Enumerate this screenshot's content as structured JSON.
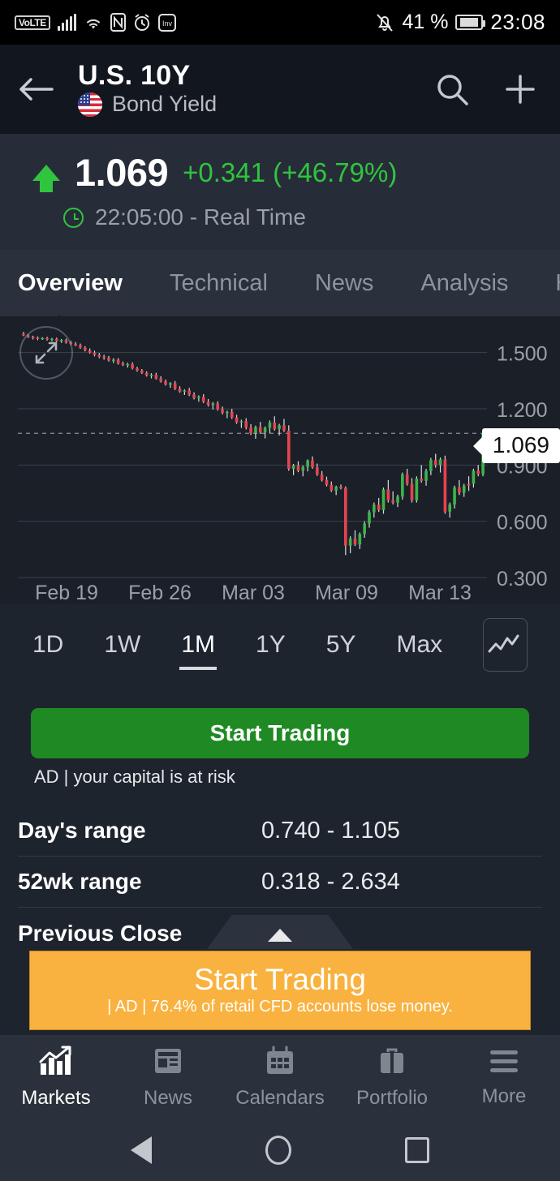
{
  "status_bar": {
    "volte": "VoLTE",
    "icons": [
      "signal-bars-icon",
      "wifi-icon",
      "nfc-icon",
      "alarm-icon",
      "investing-app-icon",
      "bell-mute-icon"
    ],
    "battery_percent": "41 %",
    "time": "23:08"
  },
  "header": {
    "title": "U.S. 10Y",
    "subtitle": "Bond Yield",
    "flag": "us-flag-icon",
    "back_icon": "back-arrow-icon",
    "search_icon": "search-icon",
    "add_icon": "plus-icon"
  },
  "quote": {
    "price": "1.069",
    "change": "+0.341 (+46.79%)",
    "direction": "up",
    "time": "22:05:00 - Real Time",
    "up_color": "#31c43f"
  },
  "tabs": [
    {
      "label": "Overview",
      "active": true
    },
    {
      "label": "Technical",
      "active": false
    },
    {
      "label": "News",
      "active": false
    },
    {
      "label": "Analysis",
      "active": false
    },
    {
      "label": "H",
      "active": false
    }
  ],
  "chart_data": {
    "type": "candlestick",
    "title": "U.S. 10Y Bond Yield",
    "xlabel": "",
    "ylabel": "",
    "ylim": [
      0.3,
      1.65
    ],
    "yticks": [
      "1.500",
      "1.200",
      "0.900",
      "0.600",
      "0.300"
    ],
    "ytick_values": [
      1.5,
      1.2,
      0.9,
      0.6,
      0.3
    ],
    "xticks": [
      "Feb 19",
      "Feb 26",
      "Mar 03",
      "Mar 09",
      "Mar 13"
    ],
    "current_price_label": "1.069",
    "current_price": 1.069,
    "grid": true,
    "up_color": "#3cb44a",
    "down_color": "#e8434f",
    "candles": [
      {
        "o": 1.6,
        "h": 1.61,
        "l": 1.588,
        "c": 1.592,
        "d": "down"
      },
      {
        "o": 1.592,
        "h": 1.598,
        "l": 1.578,
        "c": 1.584,
        "d": "down"
      },
      {
        "o": 1.584,
        "h": 1.59,
        "l": 1.57,
        "c": 1.58,
        "d": "down"
      },
      {
        "o": 1.58,
        "h": 1.586,
        "l": 1.566,
        "c": 1.574,
        "d": "down"
      },
      {
        "o": 1.574,
        "h": 1.582,
        "l": 1.568,
        "c": 1.578,
        "d": "up"
      },
      {
        "o": 1.578,
        "h": 1.584,
        "l": 1.564,
        "c": 1.57,
        "d": "down"
      },
      {
        "o": 1.57,
        "h": 1.578,
        "l": 1.56,
        "c": 1.574,
        "d": "up"
      },
      {
        "o": 1.574,
        "h": 1.58,
        "l": 1.556,
        "c": 1.562,
        "d": "down"
      },
      {
        "o": 1.562,
        "h": 1.572,
        "l": 1.552,
        "c": 1.566,
        "d": "up"
      },
      {
        "o": 1.566,
        "h": 1.574,
        "l": 1.548,
        "c": 1.554,
        "d": "down"
      },
      {
        "o": 1.554,
        "h": 1.562,
        "l": 1.54,
        "c": 1.546,
        "d": "down"
      },
      {
        "o": 1.546,
        "h": 1.556,
        "l": 1.534,
        "c": 1.54,
        "d": "down"
      },
      {
        "o": 1.54,
        "h": 1.548,
        "l": 1.52,
        "c": 1.526,
        "d": "down"
      },
      {
        "o": 1.526,
        "h": 1.534,
        "l": 1.506,
        "c": 1.512,
        "d": "down"
      },
      {
        "o": 1.512,
        "h": 1.522,
        "l": 1.494,
        "c": 1.5,
        "d": "down"
      },
      {
        "o": 1.5,
        "h": 1.51,
        "l": 1.48,
        "c": 1.488,
        "d": "down"
      },
      {
        "o": 1.488,
        "h": 1.498,
        "l": 1.47,
        "c": 1.478,
        "d": "down"
      },
      {
        "o": 1.478,
        "h": 1.488,
        "l": 1.462,
        "c": 1.472,
        "d": "down"
      },
      {
        "o": 1.472,
        "h": 1.482,
        "l": 1.452,
        "c": 1.458,
        "d": "down"
      },
      {
        "o": 1.458,
        "h": 1.47,
        "l": 1.444,
        "c": 1.462,
        "d": "up"
      },
      {
        "o": 1.462,
        "h": 1.47,
        "l": 1.436,
        "c": 1.442,
        "d": "down"
      },
      {
        "o": 1.442,
        "h": 1.452,
        "l": 1.428,
        "c": 1.434,
        "d": "down"
      },
      {
        "o": 1.434,
        "h": 1.446,
        "l": 1.42,
        "c": 1.438,
        "d": "up"
      },
      {
        "o": 1.438,
        "h": 1.448,
        "l": 1.41,
        "c": 1.416,
        "d": "down"
      },
      {
        "o": 1.416,
        "h": 1.424,
        "l": 1.398,
        "c": 1.404,
        "d": "down"
      },
      {
        "o": 1.404,
        "h": 1.412,
        "l": 1.386,
        "c": 1.392,
        "d": "down"
      },
      {
        "o": 1.392,
        "h": 1.4,
        "l": 1.372,
        "c": 1.378,
        "d": "down"
      },
      {
        "o": 1.378,
        "h": 1.39,
        "l": 1.362,
        "c": 1.382,
        "d": "up"
      },
      {
        "o": 1.382,
        "h": 1.392,
        "l": 1.356,
        "c": 1.362,
        "d": "down"
      },
      {
        "o": 1.362,
        "h": 1.374,
        "l": 1.34,
        "c": 1.346,
        "d": "down"
      },
      {
        "o": 1.346,
        "h": 1.356,
        "l": 1.324,
        "c": 1.33,
        "d": "down"
      },
      {
        "o": 1.33,
        "h": 1.342,
        "l": 1.312,
        "c": 1.336,
        "d": "up"
      },
      {
        "o": 1.336,
        "h": 1.348,
        "l": 1.3,
        "c": 1.308,
        "d": "down"
      },
      {
        "o": 1.308,
        "h": 1.32,
        "l": 1.286,
        "c": 1.292,
        "d": "down"
      },
      {
        "o": 1.292,
        "h": 1.304,
        "l": 1.274,
        "c": 1.298,
        "d": "up"
      },
      {
        "o": 1.298,
        "h": 1.312,
        "l": 1.268,
        "c": 1.276,
        "d": "down"
      },
      {
        "o": 1.276,
        "h": 1.288,
        "l": 1.25,
        "c": 1.258,
        "d": "down"
      },
      {
        "o": 1.258,
        "h": 1.272,
        "l": 1.238,
        "c": 1.264,
        "d": "up"
      },
      {
        "o": 1.264,
        "h": 1.278,
        "l": 1.23,
        "c": 1.238,
        "d": "down"
      },
      {
        "o": 1.238,
        "h": 1.252,
        "l": 1.212,
        "c": 1.22,
        "d": "down"
      },
      {
        "o": 1.22,
        "h": 1.236,
        "l": 1.196,
        "c": 1.228,
        "d": "up"
      },
      {
        "o": 1.228,
        "h": 1.24,
        "l": 1.19,
        "c": 1.198,
        "d": "down"
      },
      {
        "o": 1.198,
        "h": 1.212,
        "l": 1.17,
        "c": 1.178,
        "d": "down"
      },
      {
        "o": 1.178,
        "h": 1.19,
        "l": 1.15,
        "c": 1.184,
        "d": "up"
      },
      {
        "o": 1.184,
        "h": 1.2,
        "l": 1.146,
        "c": 1.154,
        "d": "down"
      },
      {
        "o": 1.154,
        "h": 1.168,
        "l": 1.12,
        "c": 1.128,
        "d": "down"
      },
      {
        "o": 1.128,
        "h": 1.142,
        "l": 1.098,
        "c": 1.134,
        "d": "up"
      },
      {
        "o": 1.134,
        "h": 1.15,
        "l": 1.09,
        "c": 1.1,
        "d": "down"
      },
      {
        "o": 1.1,
        "h": 1.118,
        "l": 1.06,
        "c": 1.07,
        "d": "down"
      },
      {
        "o": 1.07,
        "h": 1.11,
        "l": 1.04,
        "c": 1.102,
        "d": "up"
      },
      {
        "o": 1.102,
        "h": 1.13,
        "l": 1.066,
        "c": 1.074,
        "d": "down"
      },
      {
        "o": 1.074,
        "h": 1.106,
        "l": 1.042,
        "c": 1.098,
        "d": "up"
      },
      {
        "o": 1.098,
        "h": 1.138,
        "l": 1.07,
        "c": 1.126,
        "d": "up"
      },
      {
        "o": 1.126,
        "h": 1.16,
        "l": 1.084,
        "c": 1.092,
        "d": "down"
      },
      {
        "o": 1.092,
        "h": 1.12,
        "l": 1.058,
        "c": 1.112,
        "d": "up"
      },
      {
        "o": 1.112,
        "h": 1.146,
        "l": 1.076,
        "c": 1.084,
        "d": "down"
      },
      {
        "o": 1.084,
        "h": 1.112,
        "l": 0.87,
        "c": 0.88,
        "d": "down"
      },
      {
        "o": 0.88,
        "h": 0.906,
        "l": 0.846,
        "c": 0.898,
        "d": "up"
      },
      {
        "o": 0.898,
        "h": 0.92,
        "l": 0.862,
        "c": 0.87,
        "d": "down"
      },
      {
        "o": 0.87,
        "h": 0.898,
        "l": 0.84,
        "c": 0.89,
        "d": "up"
      },
      {
        "o": 0.89,
        "h": 0.93,
        "l": 0.866,
        "c": 0.924,
        "d": "up"
      },
      {
        "o": 0.924,
        "h": 0.946,
        "l": 0.88,
        "c": 0.888,
        "d": "down"
      },
      {
        "o": 0.888,
        "h": 0.908,
        "l": 0.842,
        "c": 0.85,
        "d": "down"
      },
      {
        "o": 0.85,
        "h": 0.868,
        "l": 0.812,
        "c": 0.82,
        "d": "down"
      },
      {
        "o": 0.82,
        "h": 0.838,
        "l": 0.786,
        "c": 0.794,
        "d": "down"
      },
      {
        "o": 0.794,
        "h": 0.812,
        "l": 0.756,
        "c": 0.764,
        "d": "down"
      },
      {
        "o": 0.764,
        "h": 0.79,
        "l": 0.74,
        "c": 0.784,
        "d": "up"
      },
      {
        "o": 0.784,
        "h": 0.796,
        "l": 0.77,
        "c": 0.778,
        "d": "down"
      },
      {
        "o": 0.778,
        "h": 0.786,
        "l": 0.42,
        "c": 0.47,
        "d": "down"
      },
      {
        "o": 0.47,
        "h": 0.52,
        "l": 0.43,
        "c": 0.508,
        "d": "up"
      },
      {
        "o": 0.508,
        "h": 0.552,
        "l": 0.468,
        "c": 0.476,
        "d": "down"
      },
      {
        "o": 0.476,
        "h": 0.54,
        "l": 0.452,
        "c": 0.532,
        "d": "up"
      },
      {
        "o": 0.532,
        "h": 0.6,
        "l": 0.512,
        "c": 0.588,
        "d": "up"
      },
      {
        "o": 0.588,
        "h": 0.66,
        "l": 0.566,
        "c": 0.648,
        "d": "up"
      },
      {
        "o": 0.648,
        "h": 0.7,
        "l": 0.62,
        "c": 0.688,
        "d": "up"
      },
      {
        "o": 0.688,
        "h": 0.724,
        "l": 0.65,
        "c": 0.66,
        "d": "down"
      },
      {
        "o": 0.66,
        "h": 0.78,
        "l": 0.64,
        "c": 0.77,
        "d": "up"
      },
      {
        "o": 0.77,
        "h": 0.82,
        "l": 0.7,
        "c": 0.712,
        "d": "down"
      },
      {
        "o": 0.712,
        "h": 0.76,
        "l": 0.69,
        "c": 0.7,
        "d": "down"
      },
      {
        "o": 0.7,
        "h": 0.742,
        "l": 0.676,
        "c": 0.732,
        "d": "up"
      },
      {
        "o": 0.732,
        "h": 0.86,
        "l": 0.716,
        "c": 0.85,
        "d": "up"
      },
      {
        "o": 0.85,
        "h": 0.88,
        "l": 0.79,
        "c": 0.8,
        "d": "down"
      },
      {
        "o": 0.8,
        "h": 0.83,
        "l": 0.7,
        "c": 0.712,
        "d": "down"
      },
      {
        "o": 0.712,
        "h": 0.84,
        "l": 0.7,
        "c": 0.828,
        "d": "up"
      },
      {
        "o": 0.828,
        "h": 0.9,
        "l": 0.806,
        "c": 0.816,
        "d": "down"
      },
      {
        "o": 0.816,
        "h": 0.88,
        "l": 0.79,
        "c": 0.868,
        "d": "up"
      },
      {
        "o": 0.868,
        "h": 0.938,
        "l": 0.846,
        "c": 0.926,
        "d": "up"
      },
      {
        "o": 0.926,
        "h": 0.96,
        "l": 0.886,
        "c": 0.9,
        "d": "down"
      },
      {
        "o": 0.9,
        "h": 0.94,
        "l": 0.86,
        "c": 0.93,
        "d": "up"
      },
      {
        "o": 0.93,
        "h": 0.95,
        "l": 0.64,
        "c": 0.652,
        "d": "down"
      },
      {
        "o": 0.652,
        "h": 0.7,
        "l": 0.62,
        "c": 0.69,
        "d": "up"
      },
      {
        "o": 0.69,
        "h": 0.79,
        "l": 0.668,
        "c": 0.78,
        "d": "up"
      },
      {
        "o": 0.78,
        "h": 0.82,
        "l": 0.74,
        "c": 0.752,
        "d": "down"
      },
      {
        "o": 0.752,
        "h": 0.8,
        "l": 0.73,
        "c": 0.79,
        "d": "up"
      },
      {
        "o": 0.79,
        "h": 0.84,
        "l": 0.762,
        "c": 0.8,
        "d": "down"
      },
      {
        "o": 0.8,
        "h": 0.88,
        "l": 0.78,
        "c": 0.87,
        "d": "up"
      },
      {
        "o": 0.87,
        "h": 0.9,
        "l": 0.84,
        "c": 0.852,
        "d": "down"
      },
      {
        "o": 0.852,
        "h": 1.075,
        "l": 0.84,
        "c": 1.069,
        "d": "up"
      }
    ]
  },
  "chart_controls": {
    "expand_icon": "expand-fullscreen-icon",
    "chart_type_icon": "line-chart-icon",
    "timeframes": [
      {
        "label": "1D",
        "active": false
      },
      {
        "label": "1W",
        "active": false
      },
      {
        "label": "1M",
        "active": true
      },
      {
        "label": "1Y",
        "active": false
      },
      {
        "label": "5Y",
        "active": false
      },
      {
        "label": "Max",
        "active": false
      }
    ]
  },
  "cta": {
    "label": "Start Trading",
    "disclaimer": "AD | your capital is at risk",
    "color": "#1f8a24"
  },
  "details": [
    {
      "label": "Day's range",
      "value": "0.740 - 1.105"
    },
    {
      "label": "52wk range",
      "value": "0.318 - 2.634"
    },
    {
      "label": "Previous Close",
      "value": ""
    }
  ],
  "collapse_handle": {
    "icon": "chevron-up-icon"
  },
  "ad_banner": {
    "title": "Start Trading",
    "subtitle": "| AD | 76.4% of retail CFD accounts lose money.",
    "color": "#f9b23f"
  },
  "bottom_nav": [
    {
      "label": "Markets",
      "icon": "markets-chart-icon",
      "active": true
    },
    {
      "label": "News",
      "icon": "news-icon",
      "active": false
    },
    {
      "label": "Calendars",
      "icon": "calendar-icon",
      "active": false
    },
    {
      "label": "Portfolio",
      "icon": "briefcase-icon",
      "active": false
    },
    {
      "label": "More",
      "icon": "hamburger-icon",
      "active": false
    }
  ],
  "android_nav": {
    "back": "android-back-icon",
    "home": "android-home-icon",
    "recents": "android-recents-icon"
  }
}
